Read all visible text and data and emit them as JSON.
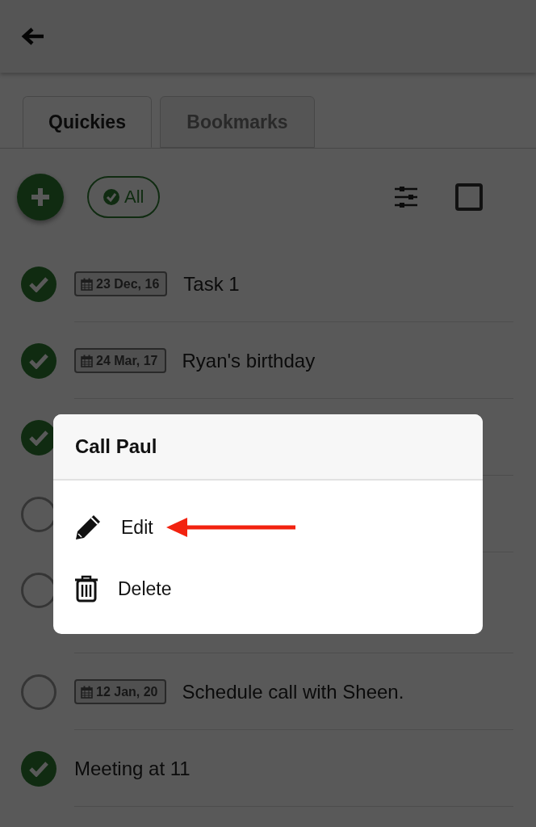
{
  "tabs": [
    {
      "label": "Quickies",
      "selected": true
    },
    {
      "label": "Bookmarks",
      "selected": false
    }
  ],
  "filter": {
    "label": "All",
    "checked": true
  },
  "select_all": {
    "checked": false
  },
  "tasks": [
    {
      "checked": true,
      "date": "23 Dec, 16",
      "title": "Task 1"
    },
    {
      "checked": true,
      "date": "24 Mar, 17",
      "title": "Ryan's birthday"
    },
    {
      "checked": true
    },
    {
      "checked": false
    },
    {
      "checked": false,
      "tall": true
    },
    {
      "checked": false,
      "date": "12 Jan, 20",
      "title": "Schedule call with Sheen."
    },
    {
      "checked": true,
      "title": "Meeting at 11"
    }
  ],
  "dialog": {
    "title": "Call Paul",
    "actions": [
      {
        "kind": "edit",
        "label": "Edit",
        "highlighted": true
      },
      {
        "kind": "delete",
        "label": "Delete",
        "highlighted": false
      }
    ]
  }
}
